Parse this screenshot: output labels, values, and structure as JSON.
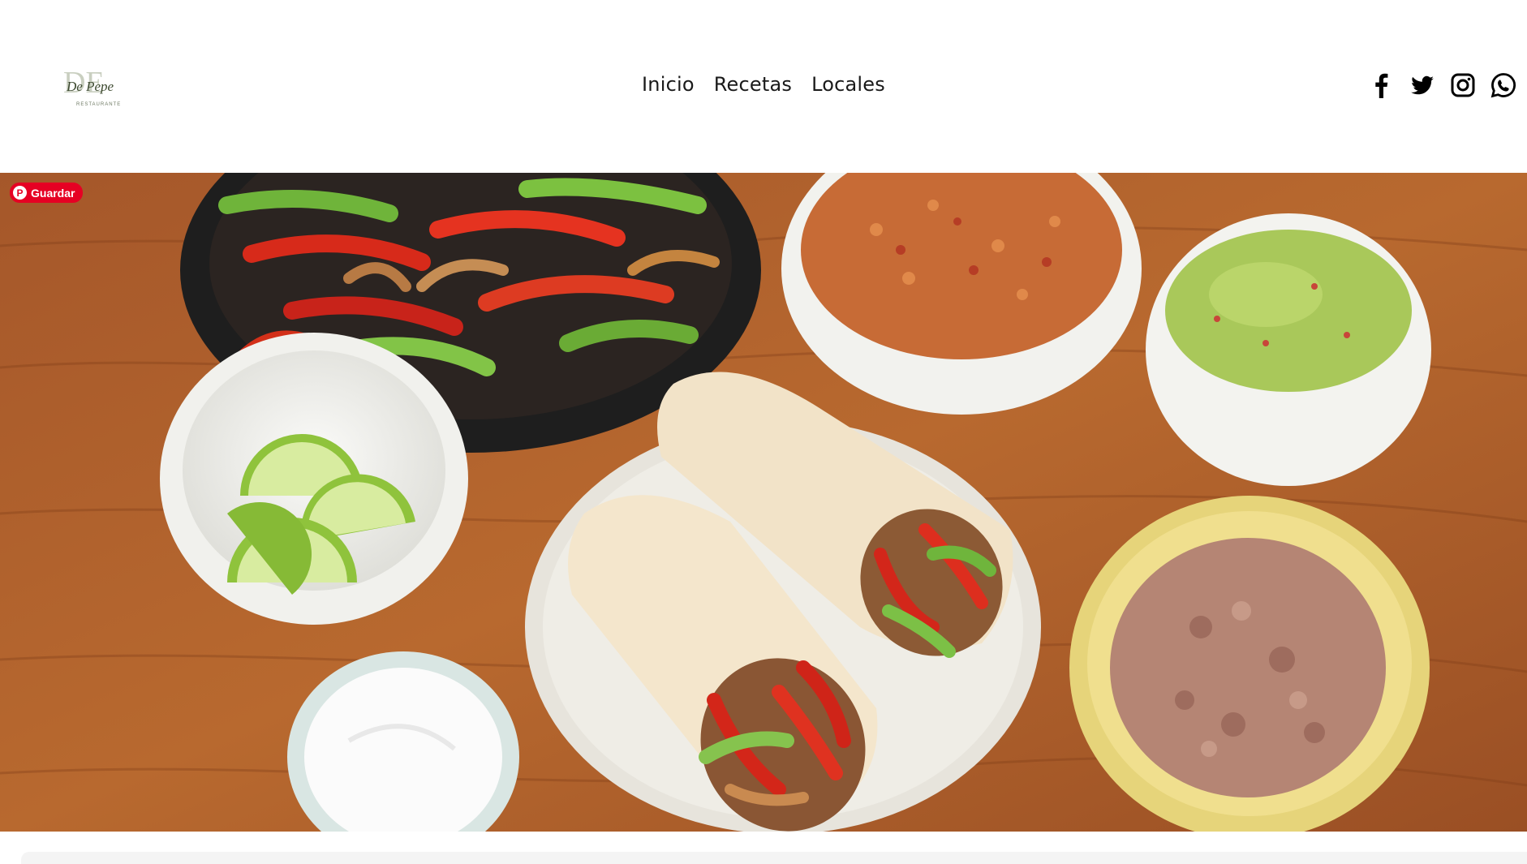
{
  "header": {
    "logo": {
      "mark": "DE",
      "script": "De Pepe",
      "subtitle": "RESTAURANTE"
    },
    "nav": [
      {
        "label": "Inicio"
      },
      {
        "label": "Recetas"
      },
      {
        "label": "Locales"
      }
    ],
    "social": [
      {
        "icon": "facebook-icon"
      },
      {
        "icon": "twitter-icon"
      },
      {
        "icon": "instagram-icon"
      },
      {
        "icon": "whatsapp-icon"
      }
    ]
  },
  "hero": {
    "image": "fajitas-burritos-spread",
    "pin_label": "Guardar",
    "colors": {
      "table": "#b0612a",
      "pin": "#e60023"
    }
  }
}
